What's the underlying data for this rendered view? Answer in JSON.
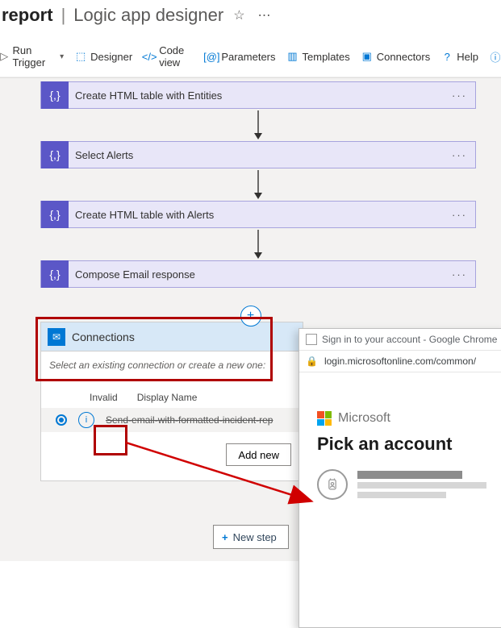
{
  "header": {
    "title_part1": "report",
    "title_part2": "Logic app designer"
  },
  "toolbar": {
    "run_trigger": "Run Trigger",
    "designer": "Designer",
    "code_view": "Code view",
    "parameters": "Parameters",
    "templates": "Templates",
    "connectors": "Connectors",
    "help": "Help"
  },
  "steps": {
    "s1": "Create HTML table with Entities",
    "s2": "Select Alerts",
    "s3": "Create HTML table with Alerts",
    "s4": "Compose Email response"
  },
  "connections": {
    "title": "Connections",
    "subtitle": "Select an existing connection or create a new one:",
    "col_invalid": "Invalid",
    "col_display": "Display Name",
    "row_name": "Send-email-with-formatted-incident-rep",
    "add_new": "Add new"
  },
  "new_step": "New step",
  "popup": {
    "tab_title": "Sign in to your account - Google Chrome",
    "url": "login.microsoftonline.com/common/",
    "brand": "Microsoft",
    "heading": "Pick an account"
  }
}
